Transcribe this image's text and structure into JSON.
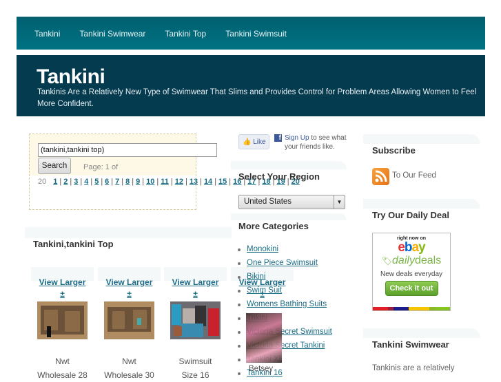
{
  "nav": {
    "items": [
      "Tankini",
      "Tankini Swimwear",
      "Tankini Top",
      "Tankini Swimsuit"
    ]
  },
  "header": {
    "title": "Tankini",
    "tagline": "Tankinis Are a Relatively New Type of Swimwear That Slims and Provides Control for Problem Areas Allowing Women to Feel More Confident."
  },
  "search": {
    "value": "(tankini,tankini top)",
    "button_label": "Search",
    "page_info": "Page: 1 of 20",
    "pages": [
      "1",
      "2",
      "3",
      "4",
      "5",
      "6",
      "7",
      "8",
      "9",
      "10",
      "11",
      "12",
      "13",
      "14",
      "15",
      "16",
      "17",
      "18",
      "19",
      "20"
    ]
  },
  "results": {
    "title": "Tankini,tankini Top",
    "view_larger_label": "View Larger",
    "plus_label": "±",
    "items": [
      {
        "caption_line1": "Nwt",
        "caption_line2": "Wholesale 28"
      },
      {
        "caption_line1": "Nwt",
        "caption_line2": "Wholesale 30"
      },
      {
        "caption_line1": "Swimsuit",
        "caption_line2": "Size 16"
      },
      {
        "caption_line1": "Betsey",
        "caption_line2": ""
      }
    ]
  },
  "facebook": {
    "like_label": "Like",
    "signup_link": "Sign Up",
    "signup_text": " to see what your friends like."
  },
  "region": {
    "title": "Select Your Region",
    "selected": "United States"
  },
  "categories": {
    "title": "More Categories",
    "items": [
      "Monokini",
      "One Piece Swimsuit",
      "Bikini",
      "Swim Suit",
      "Womens Bathing Suits",
      "Trikini",
      "Victoria Secret Swimsuit",
      "Victoria Secret Tankini",
      "Tankini Xl",
      "Tankini 16"
    ]
  },
  "subscribe": {
    "title": "Subscribe",
    "feed_label": "To Our Feed"
  },
  "daily_deal": {
    "title": "Try Our Daily Deal",
    "right_now": "right now on",
    "ebay": "ebay",
    "daily": "daily",
    "deals": "deals",
    "new_deals": "New deals everyday",
    "cta": "Check it out",
    "colors": {
      "green": "#7ab648",
      "ebay_red": "#e53238",
      "ebay_blue": "#0064d2",
      "ebay_yellow": "#f5af02",
      "ebay_green": "#86b817"
    }
  },
  "swimwear": {
    "title": "Tankini Swimwear",
    "text": "Tankinis are a relatively"
  },
  "colors": {
    "nav_bg": "#006b7c",
    "header_bg": "#053b4f",
    "link": "#1a6c85"
  }
}
